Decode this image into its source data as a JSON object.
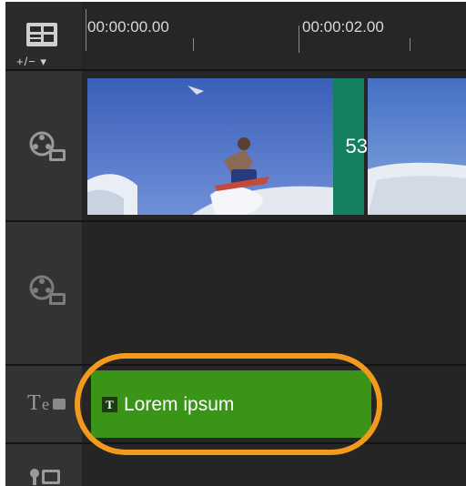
{
  "timeline": {
    "zoom_control_label": "+/− ▾",
    "ruler": {
      "timecodes": [
        "00:00:00.00",
        "00:00:02.00"
      ]
    },
    "video_track": {
      "transition_label": "53"
    },
    "title_track": {
      "clip_label": "Lorem ipsum",
      "clip_type_glyph": "T"
    },
    "track_header_glyph": "T"
  },
  "colors": {
    "title_clip": "#3a9418",
    "transition": "#15805f",
    "highlight": "#f29a1c"
  },
  "icons": [
    "storyboard-view-icon",
    "video-track-icon",
    "overlay-track-icon",
    "title-track-icon",
    "voice-track-icon"
  ]
}
